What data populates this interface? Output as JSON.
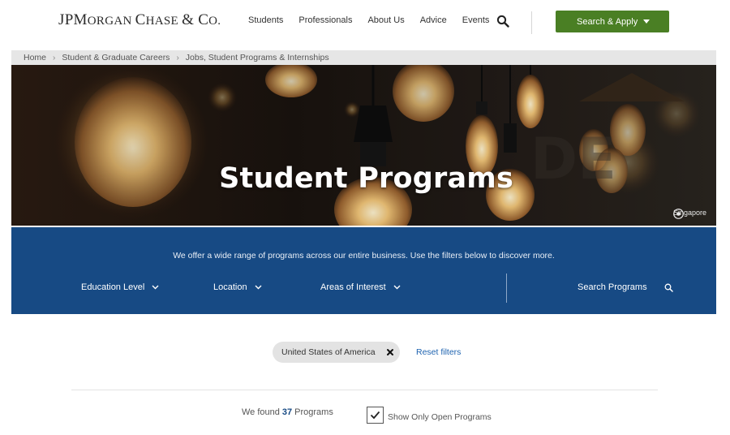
{
  "header": {
    "logo_main": "JPMorgan Chase & Co.",
    "nav": [
      "Students",
      "Professionals",
      "About Us",
      "Advice",
      "Events"
    ],
    "search_icon": "search-icon",
    "apply_label": "Search & Apply",
    "accent": "#4a7f24"
  },
  "breadcrumb": {
    "items": [
      "Home",
      "Student & Graduate Careers",
      "Jobs, Student Programs & Internships"
    ]
  },
  "hero": {
    "title": "Student Programs",
    "location": "Singapore",
    "location_icon": "camera-icon"
  },
  "filters": {
    "intro": "We offer a wide range of programs across our entire business. Use the filters below to discover more.",
    "education": "Education Level",
    "location": "Location",
    "areas": "Areas of Interest",
    "search": "Search Programs",
    "band_color": "#174a84"
  },
  "active_filters": {
    "chip": "United States of America",
    "reset": "Reset filters"
  },
  "results": {
    "prefix": "We found",
    "count": "37",
    "suffix": "Programs",
    "open_only_label": "Show Only Open Programs",
    "open_only_checked": true
  }
}
